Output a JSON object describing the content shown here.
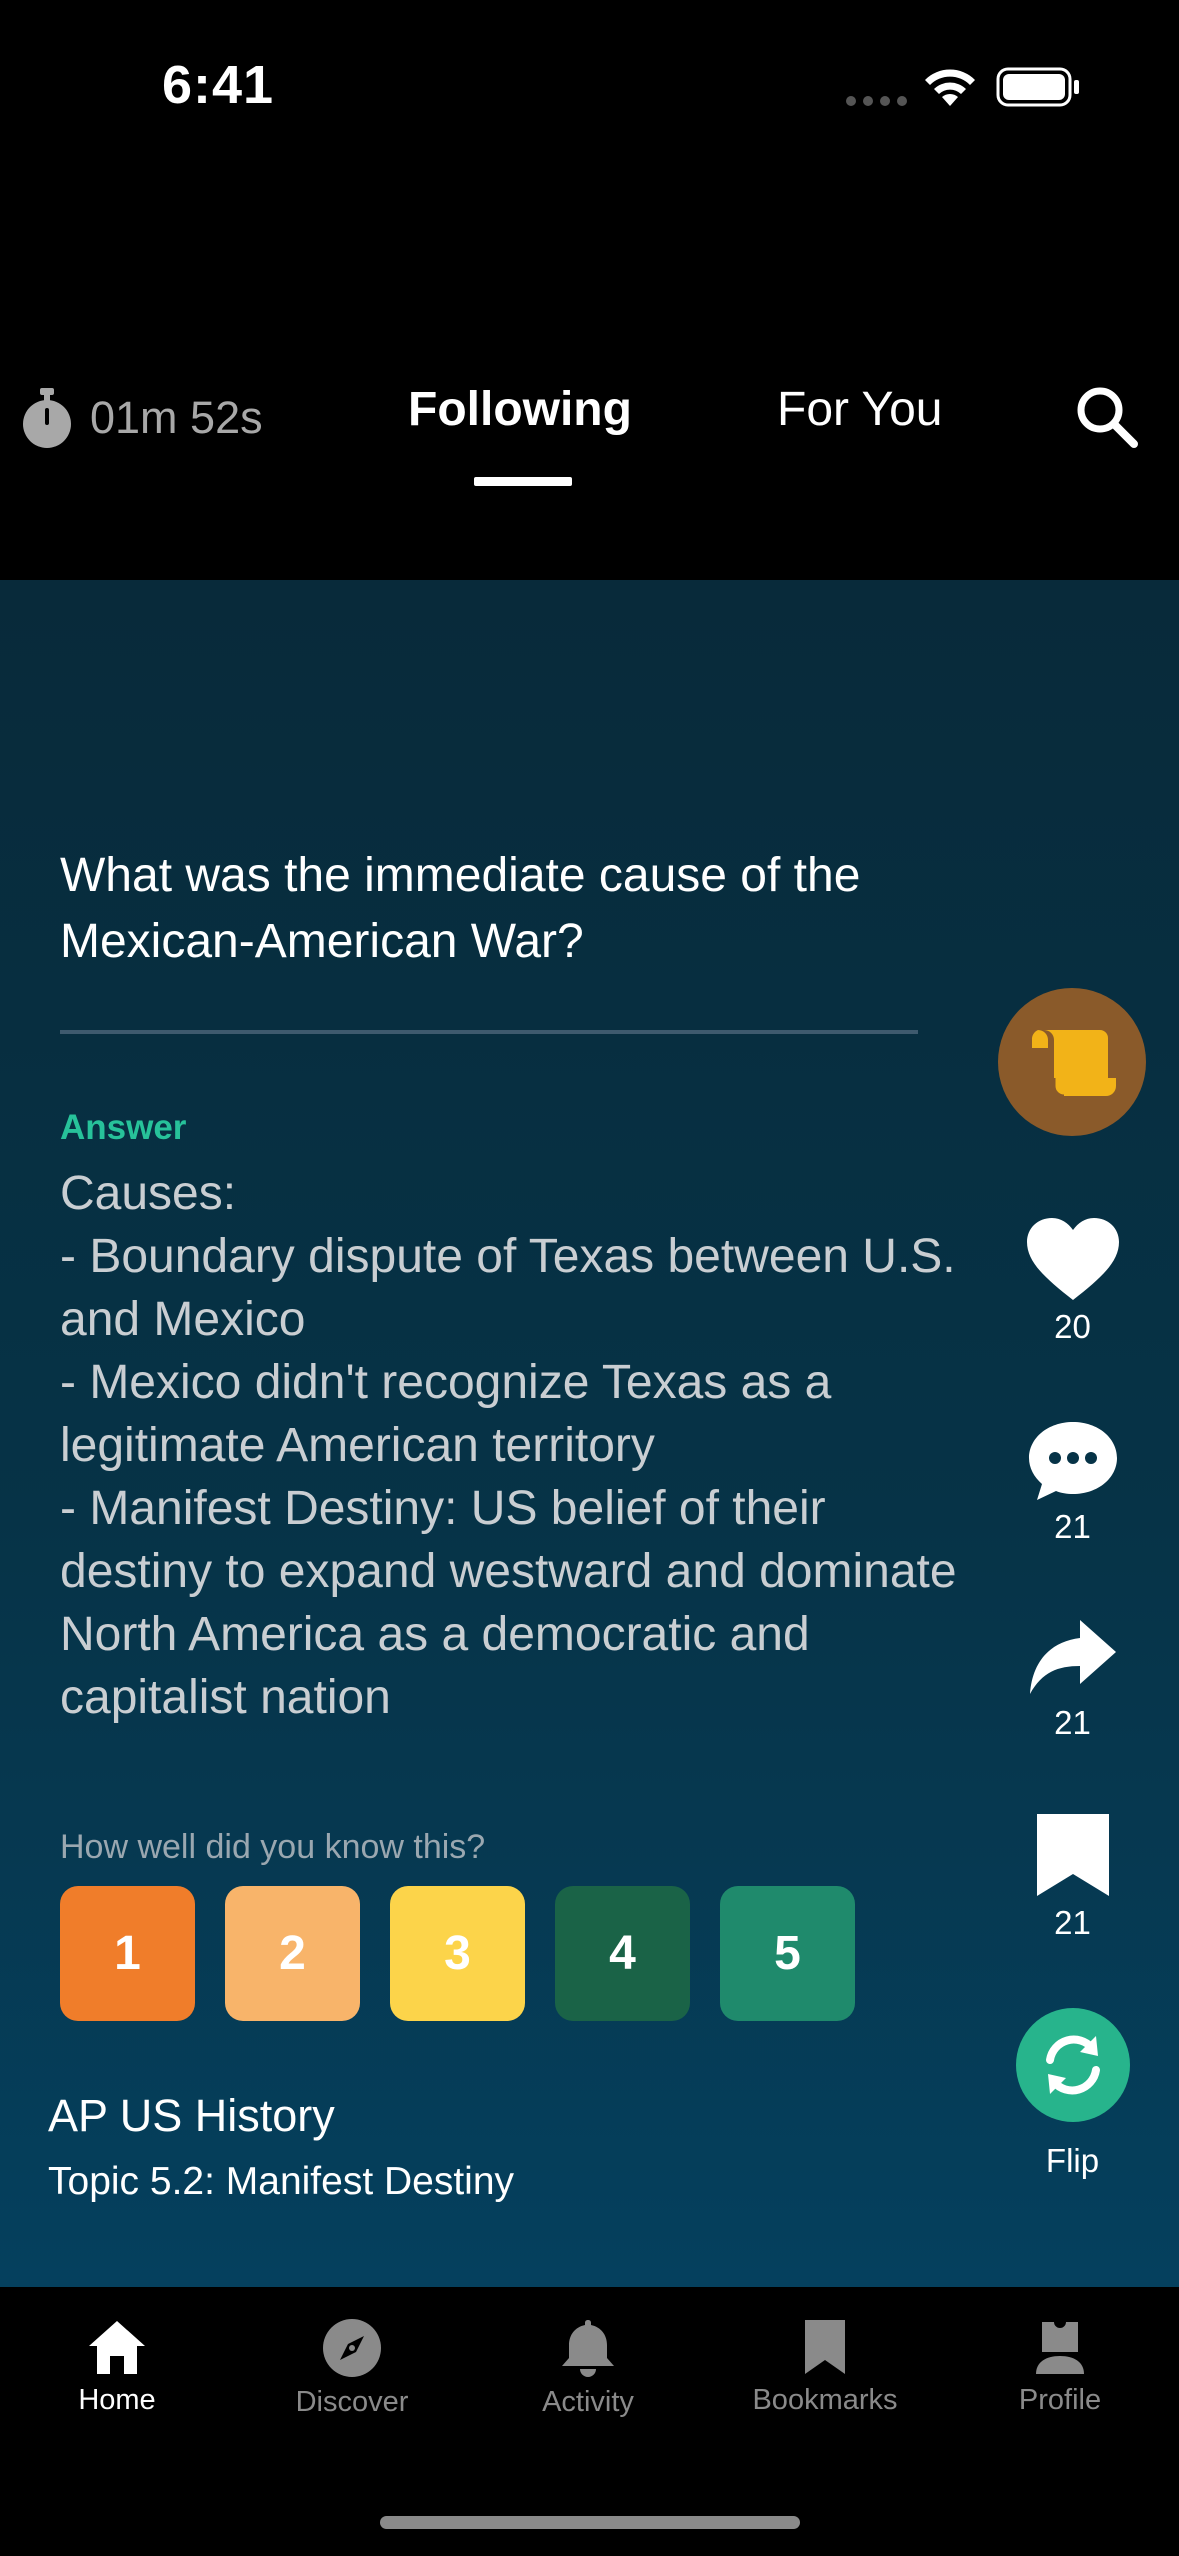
{
  "status_bar": {
    "time": "6:41"
  },
  "topnav": {
    "timer": "01m 52s",
    "tabs": [
      {
        "label": "Following",
        "active": true
      },
      {
        "label": "For You",
        "active": false
      }
    ]
  },
  "card": {
    "question": "What was the immediate cause of the Mexican-American War?",
    "answer_label": "Answer",
    "answer_text": "Causes:\n- Boundary dispute of Texas between U.S. and Mexico\n- Mexico didn't recognize Texas as a legitimate American territory\n- Manifest Destiny: US belief of their destiny to expand westward and dominate North America as a democratic and capitalist nation",
    "rating_prompt": "How well did you know this?",
    "ratings": [
      "1",
      "2",
      "3",
      "4",
      "5"
    ],
    "deck_title": "AP US History",
    "deck_topic": "Topic 5.2: Manifest Destiny"
  },
  "actions": {
    "likes": "20",
    "comments": "21",
    "shares": "21",
    "bookmarks": "21",
    "flip_label": "Flip"
  },
  "tabbar": {
    "items": [
      {
        "label": "Home",
        "icon": "home-icon",
        "active": true
      },
      {
        "label": "Discover",
        "icon": "compass-icon",
        "active": false
      },
      {
        "label": "Activity",
        "icon": "bell-icon",
        "active": false
      },
      {
        "label": "Bookmarks",
        "icon": "bookmark-icon",
        "active": false
      },
      {
        "label": "Profile",
        "icon": "person-icon",
        "active": false
      }
    ]
  },
  "colors": {
    "accent_green": "#27c29a",
    "rating_1": "#f07d2a",
    "rating_2": "#f8b46a",
    "rating_3": "#fcd44a",
    "rating_4": "#1a6347",
    "rating_5": "#1f8a6c",
    "avatar_bg": "#8a5a2a"
  }
}
